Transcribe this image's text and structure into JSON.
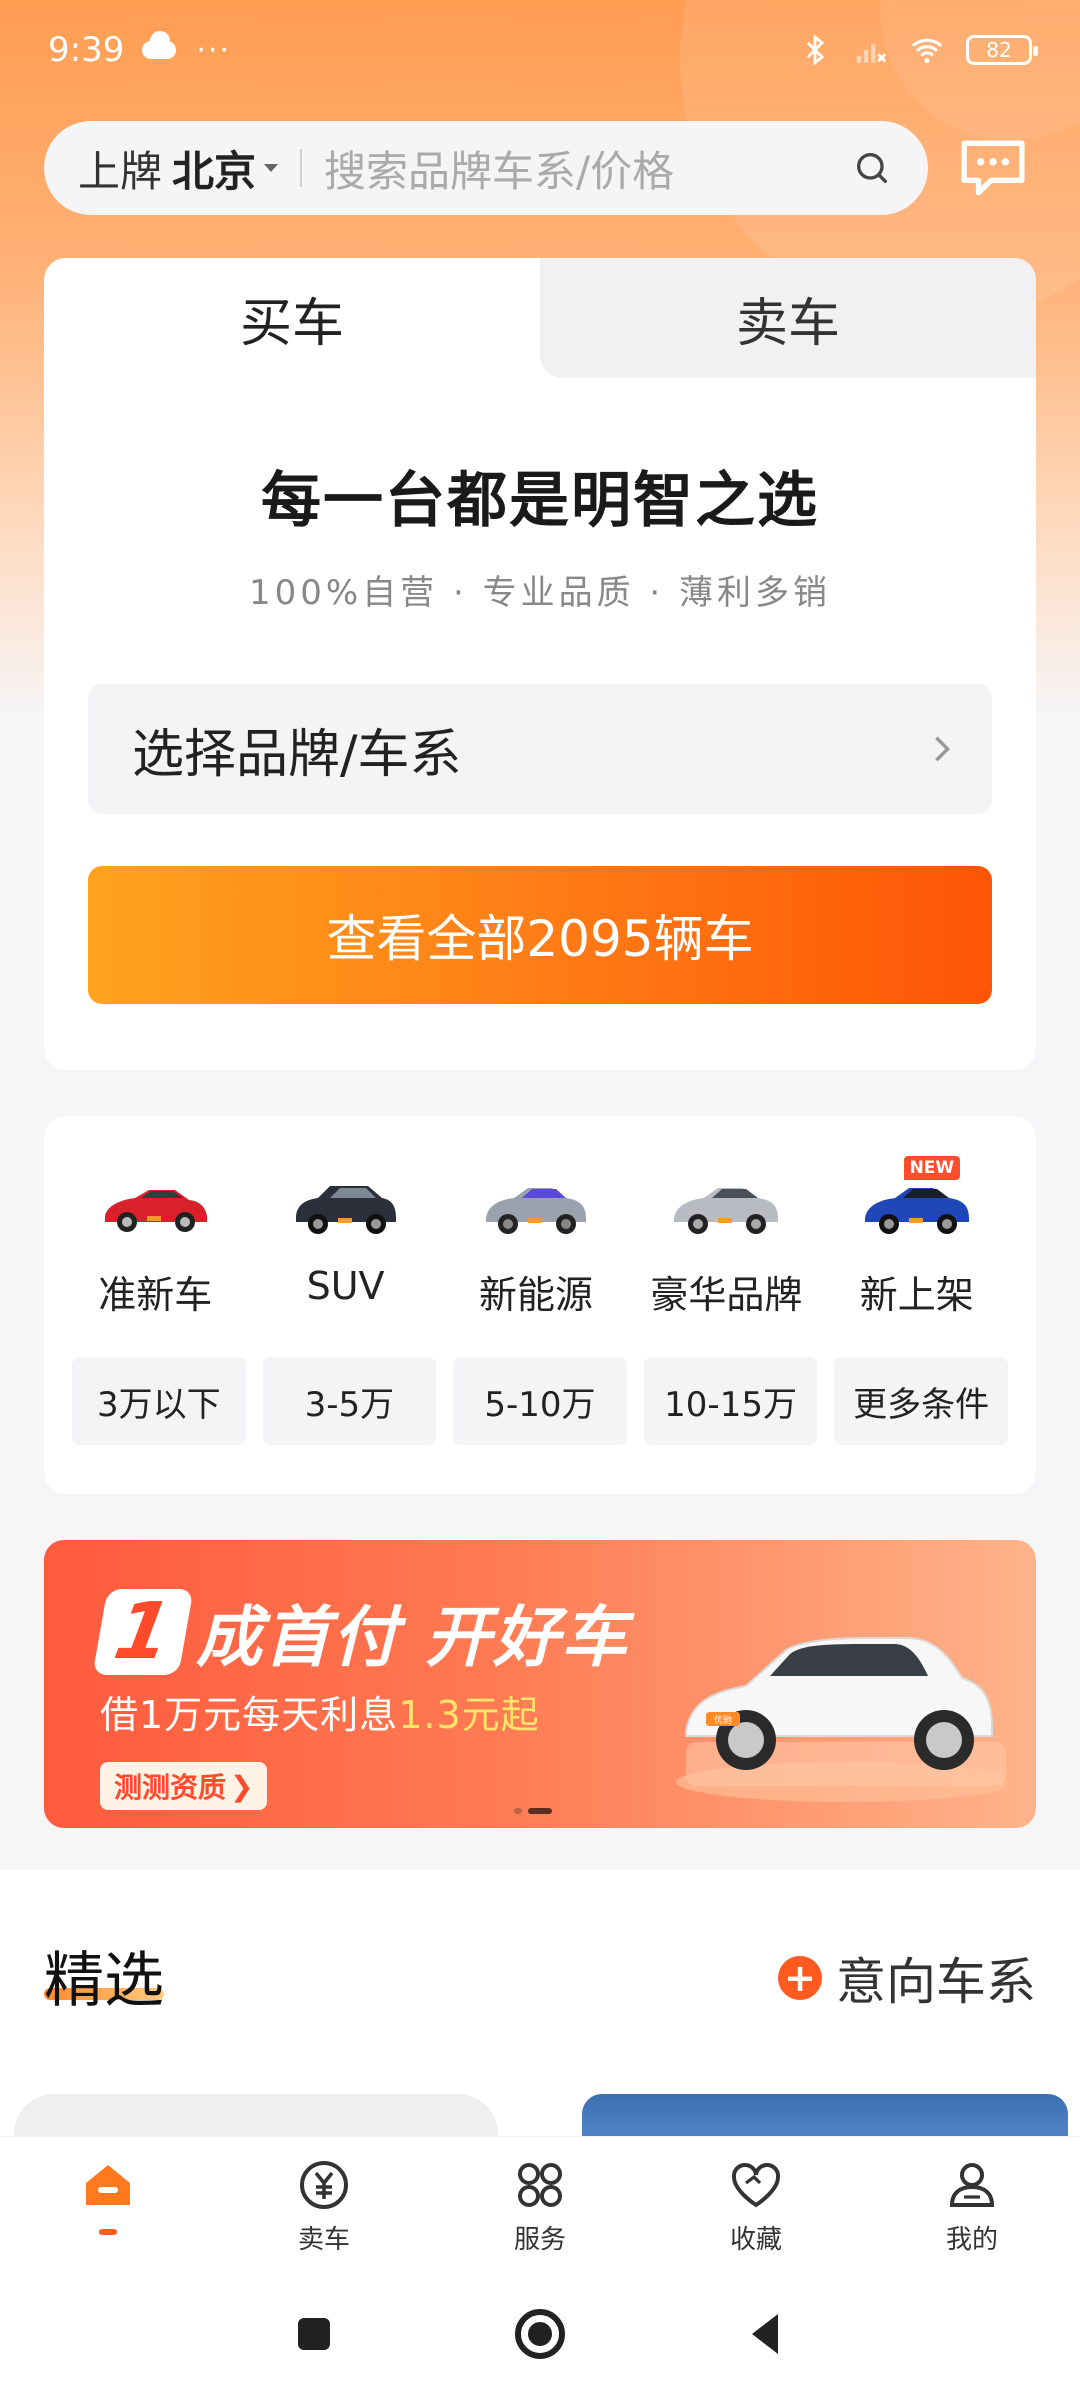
{
  "status_bar": {
    "time": "9:39",
    "dots": "···",
    "battery": "82"
  },
  "search": {
    "city_prefix": "上牌",
    "city": "北京",
    "placeholder": "搜索品牌车系/价格"
  },
  "tabs": [
    {
      "label": "买车"
    },
    {
      "label": "卖车"
    }
  ],
  "hero": {
    "headline": "每一台都是明智之选",
    "subline": "100%自营 · 专业品质 · 薄利多销",
    "brand_select": "选择品牌/车系",
    "view_all": "查看全部2095辆车"
  },
  "categories": [
    {
      "label": "准新车",
      "icon": "red-convertible-car-icon",
      "color": "#d9212b"
    },
    {
      "label": "SUV",
      "icon": "dark-suv-car-icon",
      "color": "#2b2f3a"
    },
    {
      "label": "新能源",
      "icon": "ev-car-icon",
      "color": "#9aa3ad"
    },
    {
      "label": "豪华品牌",
      "icon": "luxury-car-icon",
      "color": "#b8bcc2"
    },
    {
      "label": "新上架",
      "icon": "new-listing-car-icon",
      "color": "#1f47b8",
      "badge": "NEW"
    }
  ],
  "price_filters": [
    "3万以下",
    "3-5万",
    "5-10万",
    "10-15万",
    "更多条件"
  ],
  "banner": {
    "big_number": "1",
    "title": "成首付 开好车",
    "sub_prefix": "借1万元每天利息",
    "sub_highlight": "1.3元起",
    "button": "测测资质",
    "button_arrow": "❯",
    "plate": "优驰"
  },
  "picks": {
    "title": "精选",
    "intent": "意向车系",
    "plus": "+"
  },
  "bottom_nav": [
    {
      "label": "",
      "icon": "home-icon",
      "active": true
    },
    {
      "label": "卖车",
      "icon": "sell-car-icon"
    },
    {
      "label": "服务",
      "icon": "services-icon"
    },
    {
      "label": "收藏",
      "icon": "favorite-icon"
    },
    {
      "label": "我的",
      "icon": "profile-icon"
    }
  ],
  "colors": {
    "accent": "#ff5a1f",
    "orange_bg": "#ff9d52",
    "button_start": "#ffa31d",
    "button_end": "#ff5506"
  }
}
